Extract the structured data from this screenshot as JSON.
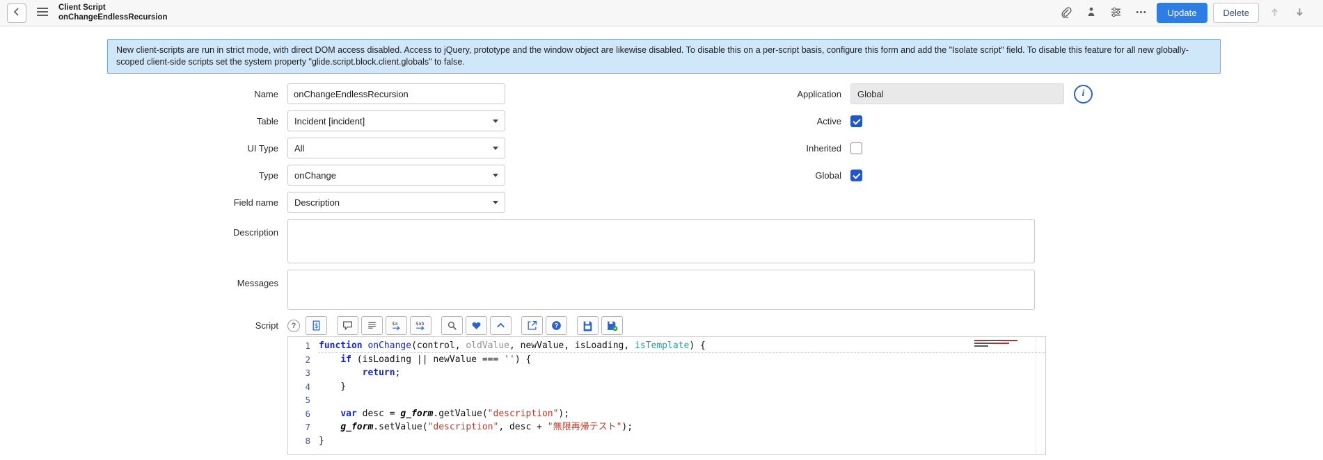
{
  "header": {
    "record_type": "Client Script",
    "record_name": "onChangeEndlessRecursion",
    "update_label": "Update",
    "delete_label": "Delete",
    "left_icons": [
      "back-icon",
      "menu-icon"
    ],
    "right_icons": [
      "attachment-icon",
      "personalize-icon",
      "form-controls-icon",
      "more-options-icon",
      "previous-record-icon",
      "next-record-icon"
    ]
  },
  "banner": {
    "text": "New client-scripts are run in strict mode, with direct DOM access disabled. Access to jQuery, prototype and the window object are likewise disabled. To disable this on a per-script basis, configure this form and add the \"Isolate script\" field. To disable this feature for all new globally-scoped client-side scripts set the system property \"glide.script.block.client.globals\" to false."
  },
  "fields": {
    "name": {
      "label": "Name",
      "value": "onChangeEndlessRecursion"
    },
    "table": {
      "label": "Table",
      "value": "Incident [incident]"
    },
    "ui_type": {
      "label": "UI Type",
      "value": "All"
    },
    "type": {
      "label": "Type",
      "value": "onChange"
    },
    "field_name": {
      "label": "Field name",
      "value": "Description"
    },
    "application": {
      "label": "Application",
      "value": "Global"
    },
    "active": {
      "label": "Active",
      "checked": true
    },
    "inherited": {
      "label": "Inherited",
      "checked": false
    },
    "global": {
      "label": "Global",
      "checked": true
    },
    "description": {
      "label": "Description",
      "value": ""
    },
    "messages": {
      "label": "Messages",
      "value": ""
    },
    "script": {
      "label": "Script"
    }
  },
  "script_editor": {
    "toolbar": [
      {
        "name": "format-script-icon"
      },
      {
        "name": "toggle-comment-icon"
      },
      {
        "name": "format-document-icon"
      },
      {
        "name": "replace-icon"
      },
      {
        "name": "replace-all-icon"
      },
      {
        "name": "search-icon"
      },
      {
        "name": "heart-icon"
      },
      {
        "name": "chevron-up-icon"
      },
      {
        "name": "open-in-window-icon"
      },
      {
        "name": "help-icon"
      },
      {
        "name": "save-icon"
      },
      {
        "name": "save-check-icon"
      }
    ],
    "lines": [
      {
        "underline": true,
        "tokens": [
          {
            "t": "function",
            "c": "k"
          },
          {
            "t": " ",
            "c": "p"
          },
          {
            "t": "onChange",
            "c": "d"
          },
          {
            "t": "(",
            "c": "p"
          },
          {
            "t": "control",
            "c": "p"
          },
          {
            "t": ", ",
            "c": "p"
          },
          {
            "t": "oldValue",
            "c": "g"
          },
          {
            "t": ", ",
            "c": "p"
          },
          {
            "t": "newValue",
            "c": "p"
          },
          {
            "t": ", ",
            "c": "p"
          },
          {
            "t": "isLoading",
            "c": "p"
          },
          {
            "t": ", ",
            "c": "p"
          },
          {
            "t": "isTemplate",
            "c": "t"
          },
          {
            "t": ") {",
            "c": "p"
          }
        ]
      },
      {
        "tokens": [
          {
            "t": "    ",
            "c": "p"
          },
          {
            "t": "if",
            "c": "k"
          },
          {
            "t": " (",
            "c": "p"
          },
          {
            "t": "isLoading",
            "c": "p"
          },
          {
            "t": " || ",
            "c": "p"
          },
          {
            "t": "newValue",
            "c": "p"
          },
          {
            "t": " === ",
            "c": "p"
          },
          {
            "t": "''",
            "c": "s"
          },
          {
            "t": ") {",
            "c": "p"
          }
        ]
      },
      {
        "tokens": [
          {
            "t": "        ",
            "c": "p"
          },
          {
            "t": "return",
            "c": "k"
          },
          {
            "t": ";",
            "c": "p"
          }
        ]
      },
      {
        "tokens": [
          {
            "t": "    }",
            "c": "p"
          }
        ]
      },
      {
        "tokens": []
      },
      {
        "tokens": [
          {
            "t": "    ",
            "c": "p"
          },
          {
            "t": "var",
            "c": "k"
          },
          {
            "t": " desc = ",
            "c": "p"
          },
          {
            "t": "g_form",
            "c": "b"
          },
          {
            "t": ".getValue(",
            "c": "p"
          },
          {
            "t": "\"description\"",
            "c": "s"
          },
          {
            "t": ");",
            "c": "p"
          }
        ]
      },
      {
        "tokens": [
          {
            "t": "    ",
            "c": "p"
          },
          {
            "t": "g_form",
            "c": "b"
          },
          {
            "t": ".setValue(",
            "c": "p"
          },
          {
            "t": "\"description\"",
            "c": "s"
          },
          {
            "t": ", desc + ",
            "c": "p"
          },
          {
            "t": "\"無限再帰テスト\"",
            "c": "s"
          },
          {
            "t": ");",
            "c": "p"
          }
        ]
      },
      {
        "tokens": [
          {
            "t": "}",
            "c": "p"
          }
        ]
      }
    ]
  }
}
